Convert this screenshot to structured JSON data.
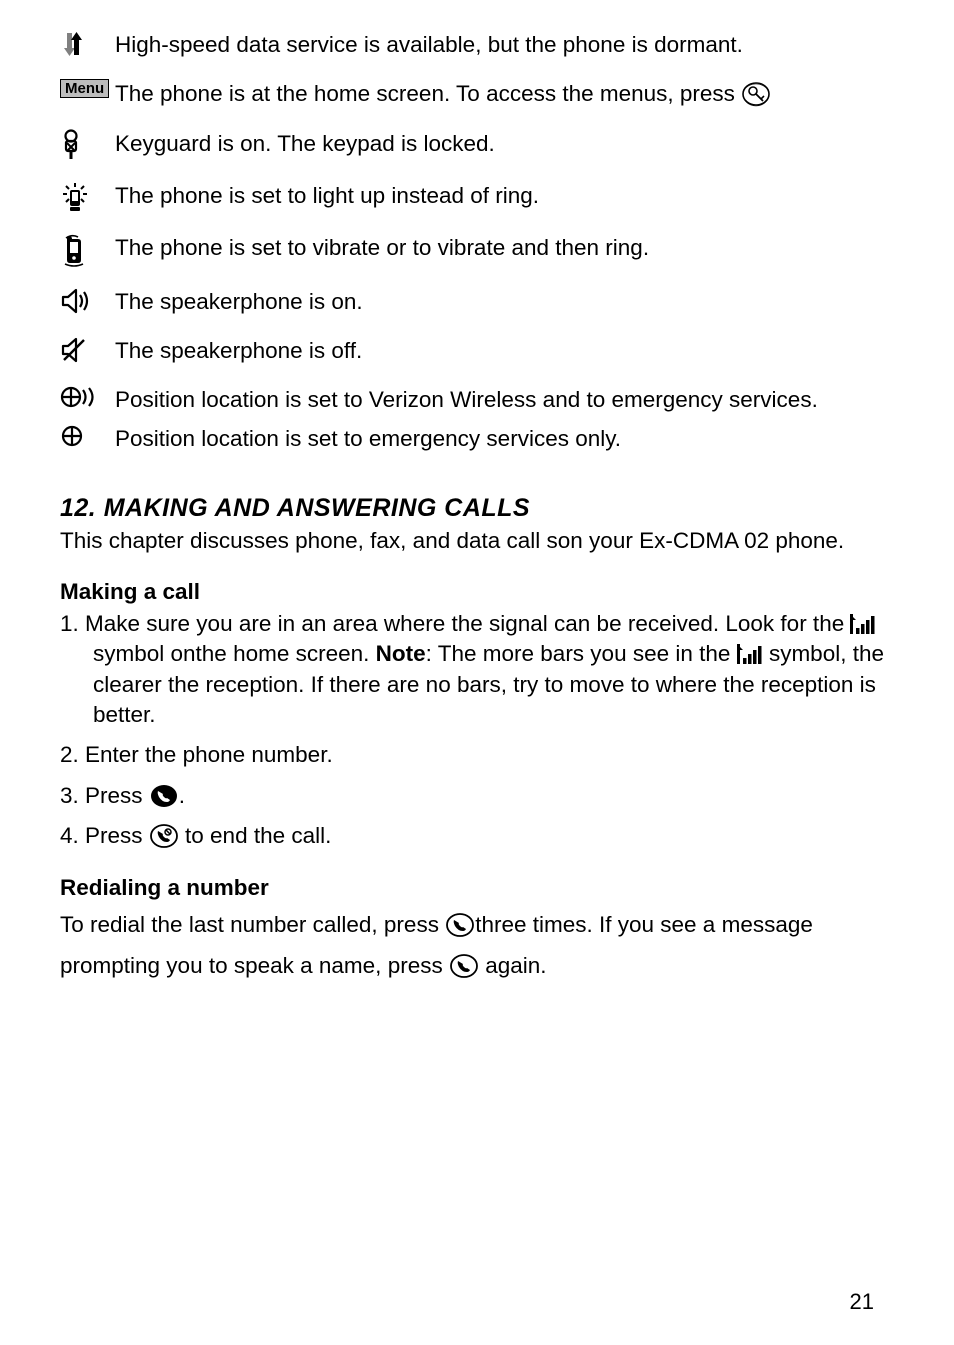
{
  "icons": [
    {
      "name": "data-dormant-icon",
      "desc": "High-speed data service is available, but the phone is dormant."
    },
    {
      "name": "menu-badge",
      "desc_a": "The phone is at the home screen. To access the menus, press ",
      "badge_text": "Menu"
    },
    {
      "name": "keyguard-icon",
      "desc": "Keyguard is on. The keypad is locked."
    },
    {
      "name": "lightup-icon",
      "desc": "The phone is set to light up instead of ring."
    },
    {
      "name": "vibrate-icon",
      "desc": "The phone is set to vibrate or to vibrate and then ring."
    },
    {
      "name": "speaker-on-icon",
      "desc": "The speakerphone is on."
    },
    {
      "name": "speaker-off-icon",
      "desc": "The speakerphone is off."
    },
    {
      "name": "location-full-icon",
      "desc": "Position location is set to Verizon Wireless and to emergency services."
    },
    {
      "name": "location-emergency-icon",
      "desc": "Position location is set to emergency services only."
    }
  ],
  "section": {
    "heading": "12. MAKING AND ANSWERING CALLS",
    "intro": "This chapter discusses phone, fax, and data call son your Ex-CDMA 02 phone."
  },
  "making_call": {
    "heading": "Making a call",
    "step1_a": "1. Make sure you are in an area where the signal can be received. Look for the ",
    "step1_b": " symbol onthe home screen. ",
    "step1_note_label": "Note",
    "step1_c": ": The more bars you see in the ",
    "step1_d": " symbol, the clearer the reception. If there are no bars, try to move to where the reception is better.",
    "step2": "2. Enter the phone number.",
    "step3_a": "3. Press ",
    "step3_b": ".",
    "step4_a": "4. Press ",
    "step4_b": " to end the call."
  },
  "redial": {
    "heading": "Redialing a number",
    "line1_a": "To redial the last number called, press  ",
    "line1_b": "three times. If you see a message prompting you to speak a name, press  ",
    "line1_c": " again."
  },
  "page_number": "21"
}
